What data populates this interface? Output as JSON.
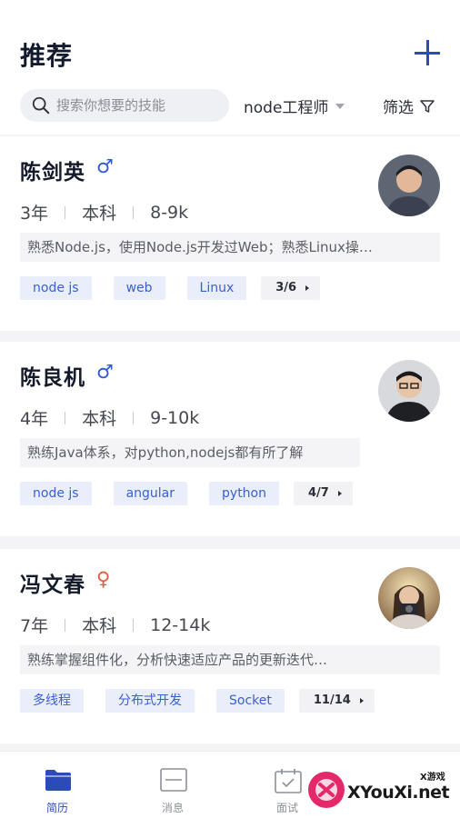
{
  "header": {
    "title": "推荐",
    "add_icon": "plus-icon",
    "accent_color": "#2b4bb8"
  },
  "search": {
    "placeholder": "搜索你想要的技能",
    "value": ""
  },
  "filters": {
    "job_label": "node工程师",
    "filter_label": "筛选"
  },
  "candidates": [
    {
      "name": "陈剑英",
      "gender": "♂",
      "experience": "3年",
      "education": "本科",
      "salary": "8-9k",
      "summary": "熟悉Node.js，使用Node.js开发过Web；熟悉Linux操…",
      "tags": [
        "node js",
        "web",
        "Linux"
      ],
      "pager": "3/6"
    },
    {
      "name": "陈良机",
      "gender": "♂",
      "experience": "4年",
      "education": "本科",
      "salary": "9-10k",
      "summary": "熟练Java体系，对python,nodejs都有所了解",
      "tags": [
        "node js",
        "angular",
        "python"
      ],
      "pager": "4/7"
    },
    {
      "name": "冯文春",
      "gender": "♀",
      "experience": "7年",
      "education": "本科",
      "salary": "12-14k",
      "summary": "熟练掌握组件化，分析快速适应产品的更新迭代…",
      "tags": [
        "多线程",
        "分布式开发",
        "Socket"
      ],
      "pager": "11/14"
    }
  ],
  "nav": {
    "items": [
      {
        "label": "简历",
        "icon": "folder-icon",
        "active": true
      },
      {
        "label": "消息",
        "icon": "message-icon",
        "active": false
      },
      {
        "label": "面试",
        "icon": "calendar-check-icon",
        "active": false
      }
    ]
  },
  "watermark": {
    "text": "XYouXi.net",
    "small": "X游戏"
  }
}
